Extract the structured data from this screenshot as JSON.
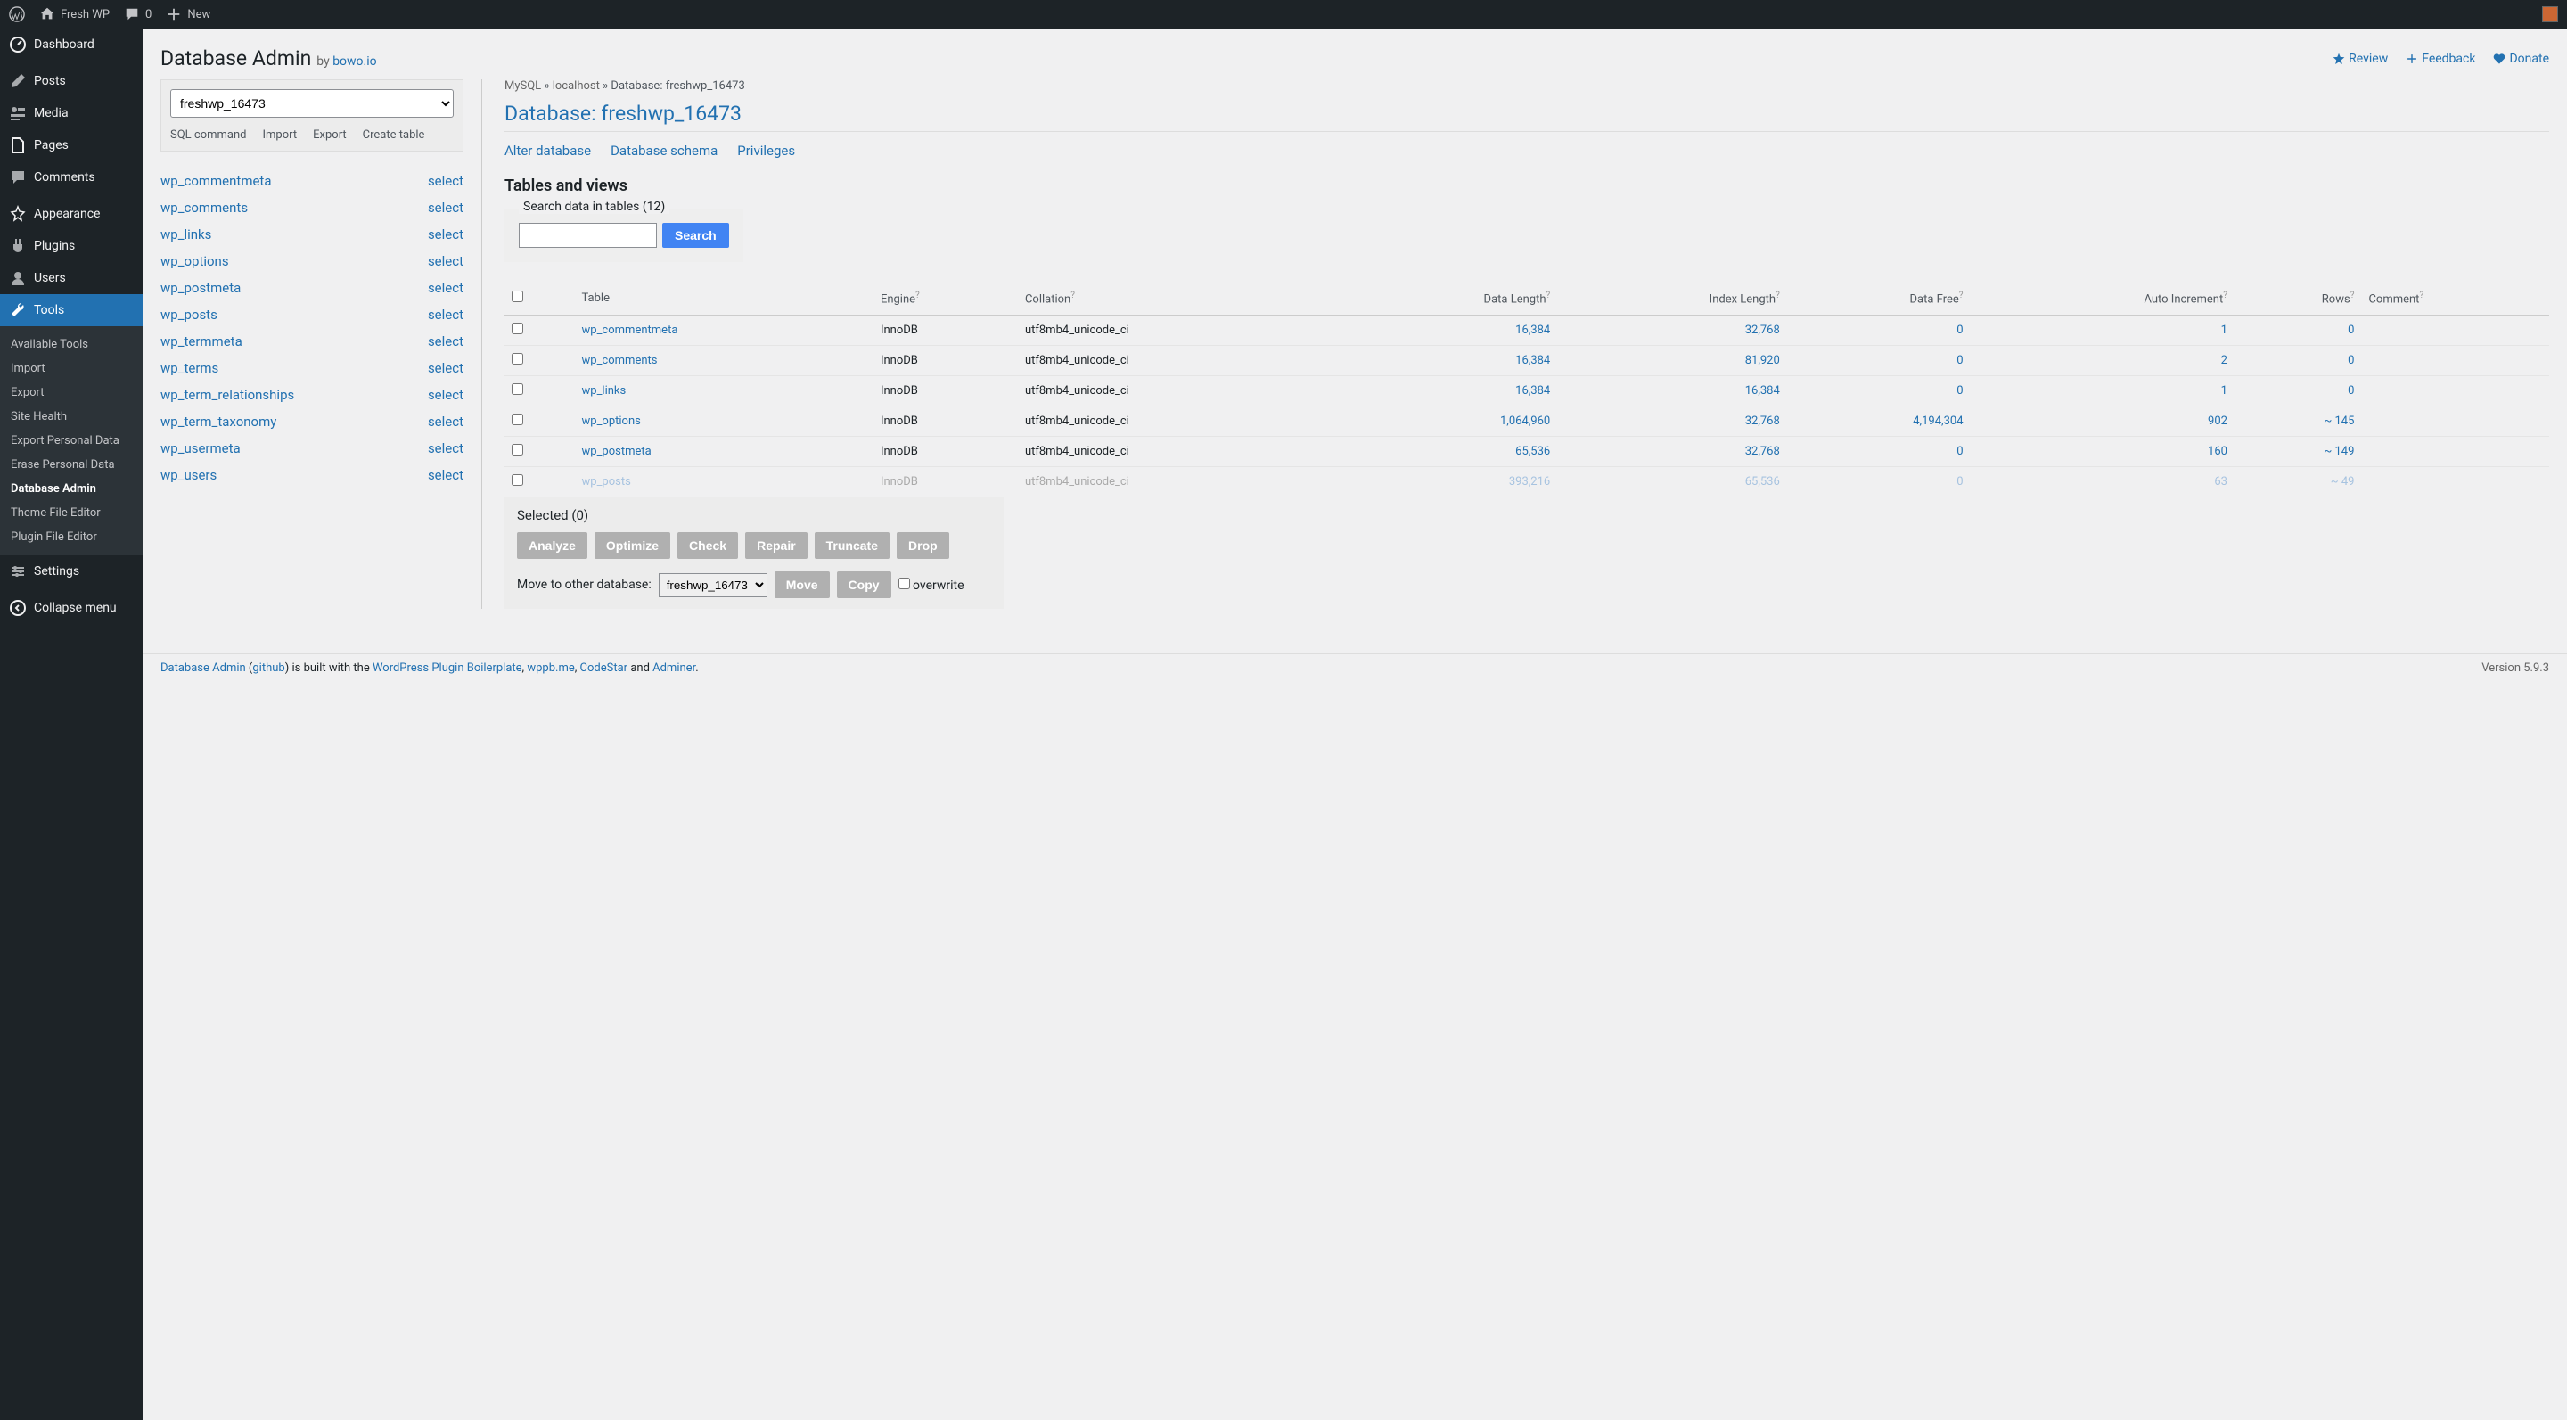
{
  "toolbar": {
    "site_name": "Fresh WP",
    "comments_count": "0",
    "new_label": "New"
  },
  "sidebar": {
    "items": [
      {
        "label": "Dashboard"
      },
      {
        "label": "Posts"
      },
      {
        "label": "Media"
      },
      {
        "label": "Pages"
      },
      {
        "label": "Comments"
      },
      {
        "label": "Appearance"
      },
      {
        "label": "Plugins"
      },
      {
        "label": "Users"
      },
      {
        "label": "Tools"
      },
      {
        "label": "Settings"
      }
    ],
    "submenu": [
      {
        "label": "Available Tools"
      },
      {
        "label": "Import"
      },
      {
        "label": "Export"
      },
      {
        "label": "Site Health"
      },
      {
        "label": "Export Personal Data"
      },
      {
        "label": "Erase Personal Data"
      },
      {
        "label": "Database Admin"
      },
      {
        "label": "Theme File Editor"
      },
      {
        "label": "Plugin File Editor"
      }
    ],
    "collapse": "Collapse menu"
  },
  "header": {
    "title": "Database Admin",
    "by": "by",
    "author": "bowo.io",
    "links": {
      "review": "Review",
      "feedback": "Feedback",
      "donate": "Donate"
    }
  },
  "left": {
    "db_selected": "freshwp_16473",
    "links": [
      "SQL command",
      "Import",
      "Export",
      "Create table"
    ],
    "tables": [
      "wp_commentmeta",
      "wp_comments",
      "wp_links",
      "wp_options",
      "wp_postmeta",
      "wp_posts",
      "wp_termmeta",
      "wp_terms",
      "wp_term_relationships",
      "wp_term_taxonomy",
      "wp_usermeta",
      "wp_users"
    ],
    "select_label": "select"
  },
  "right": {
    "breadcrumb": {
      "mysql": "MySQL",
      "host": "localhost",
      "db_prefix": "Database:",
      "db": "freshwp_16473"
    },
    "title": "Database: freshwp_16473",
    "db_links": [
      "Alter database",
      "Database schema",
      "Privileges"
    ],
    "section": "Tables and views",
    "search_legend": "Search data in tables (12)",
    "search_btn": "Search",
    "columns": [
      "Table",
      "Engine",
      "Collation",
      "Data Length",
      "Index Length",
      "Data Free",
      "Auto Increment",
      "Rows",
      "Comment"
    ],
    "rows": [
      {
        "table": "wp_commentmeta",
        "engine": "InnoDB",
        "collation": "utf8mb4_unicode_ci",
        "data": "16,384",
        "index": "32,768",
        "free": "0",
        "auto": "1",
        "rows": "0"
      },
      {
        "table": "wp_comments",
        "engine": "InnoDB",
        "collation": "utf8mb4_unicode_ci",
        "data": "16,384",
        "index": "81,920",
        "free": "0",
        "auto": "2",
        "rows": "0"
      },
      {
        "table": "wp_links",
        "engine": "InnoDB",
        "collation": "utf8mb4_unicode_ci",
        "data": "16,384",
        "index": "16,384",
        "free": "0",
        "auto": "1",
        "rows": "0"
      },
      {
        "table": "wp_options",
        "engine": "InnoDB",
        "collation": "utf8mb4_unicode_ci",
        "data": "1,064,960",
        "index": "32,768",
        "free": "4,194,304",
        "auto": "902",
        "rows": "~ 145"
      },
      {
        "table": "wp_postmeta",
        "engine": "InnoDB",
        "collation": "utf8mb4_unicode_ci",
        "data": "65,536",
        "index": "32,768",
        "free": "0",
        "auto": "160",
        "rows": "~ 149"
      },
      {
        "table": "wp_posts",
        "engine": "InnoDB",
        "collation": "utf8mb4_unicode_ci",
        "data": "393,216",
        "index": "65,536",
        "free": "0",
        "auto": "63",
        "rows": "~ 49",
        "faded": true
      }
    ],
    "selected": {
      "title": "Selected (0)",
      "actions": [
        "Analyze",
        "Optimize",
        "Check",
        "Repair",
        "Truncate",
        "Drop"
      ],
      "move_label": "Move to other database:",
      "move_db": "freshwp_16473",
      "move_btn": "Move",
      "copy_btn": "Copy",
      "overwrite": "overwrite"
    }
  },
  "footer": {
    "text_parts": {
      "p1": "Database Admin",
      "p2": "github",
      "p3": " is built with the ",
      "p4": "WordPress Plugin Boilerplate",
      "p5": "wppb.me",
      "p6": "CodeStar",
      "p7": "Adminer"
    },
    "version": "Version 5.9.3"
  }
}
